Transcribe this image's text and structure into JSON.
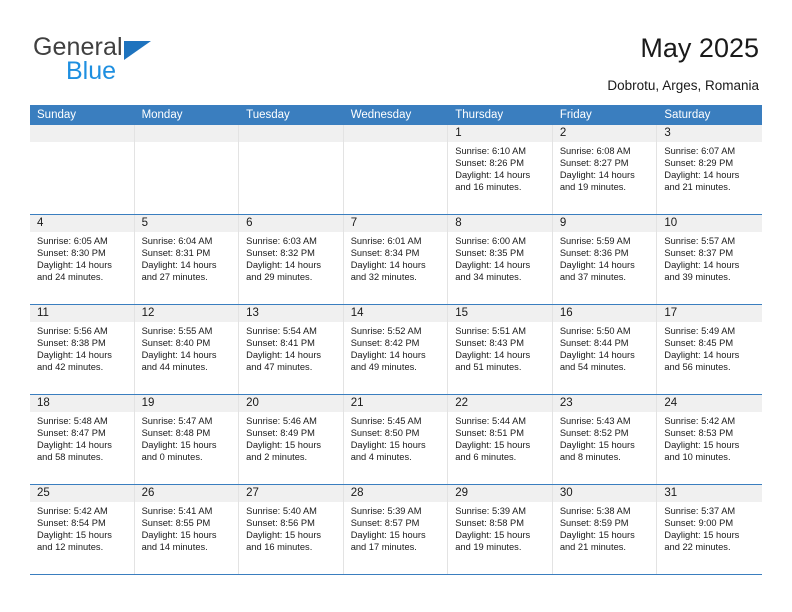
{
  "brand": {
    "name_top": "General",
    "name_bottom": "Blue",
    "accent_color": "#1e73be",
    "accent_color_light": "#1e8fe0"
  },
  "header": {
    "title": "May 2025",
    "location": "Dobrotu, Arges, Romania"
  },
  "calendar": {
    "header_bg": "#3a7ebf",
    "datebar_bg": "#f0f0f0",
    "weekdays": [
      "Sunday",
      "Monday",
      "Tuesday",
      "Wednesday",
      "Thursday",
      "Friday",
      "Saturday"
    ],
    "weeks": [
      [
        {
          "day": "",
          "sunrise": "",
          "sunset": "",
          "daylight": "",
          "empty": true
        },
        {
          "day": "",
          "sunrise": "",
          "sunset": "",
          "daylight": "",
          "empty": true
        },
        {
          "day": "",
          "sunrise": "",
          "sunset": "",
          "daylight": "",
          "empty": true
        },
        {
          "day": "",
          "sunrise": "",
          "sunset": "",
          "daylight": "",
          "empty": true
        },
        {
          "day": "1",
          "sunrise": "Sunrise: 6:10 AM",
          "sunset": "Sunset: 8:26 PM",
          "daylight": "Daylight: 14 hours and 16 minutes."
        },
        {
          "day": "2",
          "sunrise": "Sunrise: 6:08 AM",
          "sunset": "Sunset: 8:27 PM",
          "daylight": "Daylight: 14 hours and 19 minutes."
        },
        {
          "day": "3",
          "sunrise": "Sunrise: 6:07 AM",
          "sunset": "Sunset: 8:29 PM",
          "daylight": "Daylight: 14 hours and 21 minutes."
        }
      ],
      [
        {
          "day": "4",
          "sunrise": "Sunrise: 6:05 AM",
          "sunset": "Sunset: 8:30 PM",
          "daylight": "Daylight: 14 hours and 24 minutes."
        },
        {
          "day": "5",
          "sunrise": "Sunrise: 6:04 AM",
          "sunset": "Sunset: 8:31 PM",
          "daylight": "Daylight: 14 hours and 27 minutes."
        },
        {
          "day": "6",
          "sunrise": "Sunrise: 6:03 AM",
          "sunset": "Sunset: 8:32 PM",
          "daylight": "Daylight: 14 hours and 29 minutes."
        },
        {
          "day": "7",
          "sunrise": "Sunrise: 6:01 AM",
          "sunset": "Sunset: 8:34 PM",
          "daylight": "Daylight: 14 hours and 32 minutes."
        },
        {
          "day": "8",
          "sunrise": "Sunrise: 6:00 AM",
          "sunset": "Sunset: 8:35 PM",
          "daylight": "Daylight: 14 hours and 34 minutes."
        },
        {
          "day": "9",
          "sunrise": "Sunrise: 5:59 AM",
          "sunset": "Sunset: 8:36 PM",
          "daylight": "Daylight: 14 hours and 37 minutes."
        },
        {
          "day": "10",
          "sunrise": "Sunrise: 5:57 AM",
          "sunset": "Sunset: 8:37 PM",
          "daylight": "Daylight: 14 hours and 39 minutes."
        }
      ],
      [
        {
          "day": "11",
          "sunrise": "Sunrise: 5:56 AM",
          "sunset": "Sunset: 8:38 PM",
          "daylight": "Daylight: 14 hours and 42 minutes."
        },
        {
          "day": "12",
          "sunrise": "Sunrise: 5:55 AM",
          "sunset": "Sunset: 8:40 PM",
          "daylight": "Daylight: 14 hours and 44 minutes."
        },
        {
          "day": "13",
          "sunrise": "Sunrise: 5:54 AM",
          "sunset": "Sunset: 8:41 PM",
          "daylight": "Daylight: 14 hours and 47 minutes."
        },
        {
          "day": "14",
          "sunrise": "Sunrise: 5:52 AM",
          "sunset": "Sunset: 8:42 PM",
          "daylight": "Daylight: 14 hours and 49 minutes."
        },
        {
          "day": "15",
          "sunrise": "Sunrise: 5:51 AM",
          "sunset": "Sunset: 8:43 PM",
          "daylight": "Daylight: 14 hours and 51 minutes."
        },
        {
          "day": "16",
          "sunrise": "Sunrise: 5:50 AM",
          "sunset": "Sunset: 8:44 PM",
          "daylight": "Daylight: 14 hours and 54 minutes."
        },
        {
          "day": "17",
          "sunrise": "Sunrise: 5:49 AM",
          "sunset": "Sunset: 8:45 PM",
          "daylight": "Daylight: 14 hours and 56 minutes."
        }
      ],
      [
        {
          "day": "18",
          "sunrise": "Sunrise: 5:48 AM",
          "sunset": "Sunset: 8:47 PM",
          "daylight": "Daylight: 14 hours and 58 minutes."
        },
        {
          "day": "19",
          "sunrise": "Sunrise: 5:47 AM",
          "sunset": "Sunset: 8:48 PM",
          "daylight": "Daylight: 15 hours and 0 minutes."
        },
        {
          "day": "20",
          "sunrise": "Sunrise: 5:46 AM",
          "sunset": "Sunset: 8:49 PM",
          "daylight": "Daylight: 15 hours and 2 minutes."
        },
        {
          "day": "21",
          "sunrise": "Sunrise: 5:45 AM",
          "sunset": "Sunset: 8:50 PM",
          "daylight": "Daylight: 15 hours and 4 minutes."
        },
        {
          "day": "22",
          "sunrise": "Sunrise: 5:44 AM",
          "sunset": "Sunset: 8:51 PM",
          "daylight": "Daylight: 15 hours and 6 minutes."
        },
        {
          "day": "23",
          "sunrise": "Sunrise: 5:43 AM",
          "sunset": "Sunset: 8:52 PM",
          "daylight": "Daylight: 15 hours and 8 minutes."
        },
        {
          "day": "24",
          "sunrise": "Sunrise: 5:42 AM",
          "sunset": "Sunset: 8:53 PM",
          "daylight": "Daylight: 15 hours and 10 minutes."
        }
      ],
      [
        {
          "day": "25",
          "sunrise": "Sunrise: 5:42 AM",
          "sunset": "Sunset: 8:54 PM",
          "daylight": "Daylight: 15 hours and 12 minutes."
        },
        {
          "day": "26",
          "sunrise": "Sunrise: 5:41 AM",
          "sunset": "Sunset: 8:55 PM",
          "daylight": "Daylight: 15 hours and 14 minutes."
        },
        {
          "day": "27",
          "sunrise": "Sunrise: 5:40 AM",
          "sunset": "Sunset: 8:56 PM",
          "daylight": "Daylight: 15 hours and 16 minutes."
        },
        {
          "day": "28",
          "sunrise": "Sunrise: 5:39 AM",
          "sunset": "Sunset: 8:57 PM",
          "daylight": "Daylight: 15 hours and 17 minutes."
        },
        {
          "day": "29",
          "sunrise": "Sunrise: 5:39 AM",
          "sunset": "Sunset: 8:58 PM",
          "daylight": "Daylight: 15 hours and 19 minutes."
        },
        {
          "day": "30",
          "sunrise": "Sunrise: 5:38 AM",
          "sunset": "Sunset: 8:59 PM",
          "daylight": "Daylight: 15 hours and 21 minutes."
        },
        {
          "day": "31",
          "sunrise": "Sunrise: 5:37 AM",
          "sunset": "Sunset: 9:00 PM",
          "daylight": "Daylight: 15 hours and 22 minutes."
        }
      ]
    ]
  }
}
